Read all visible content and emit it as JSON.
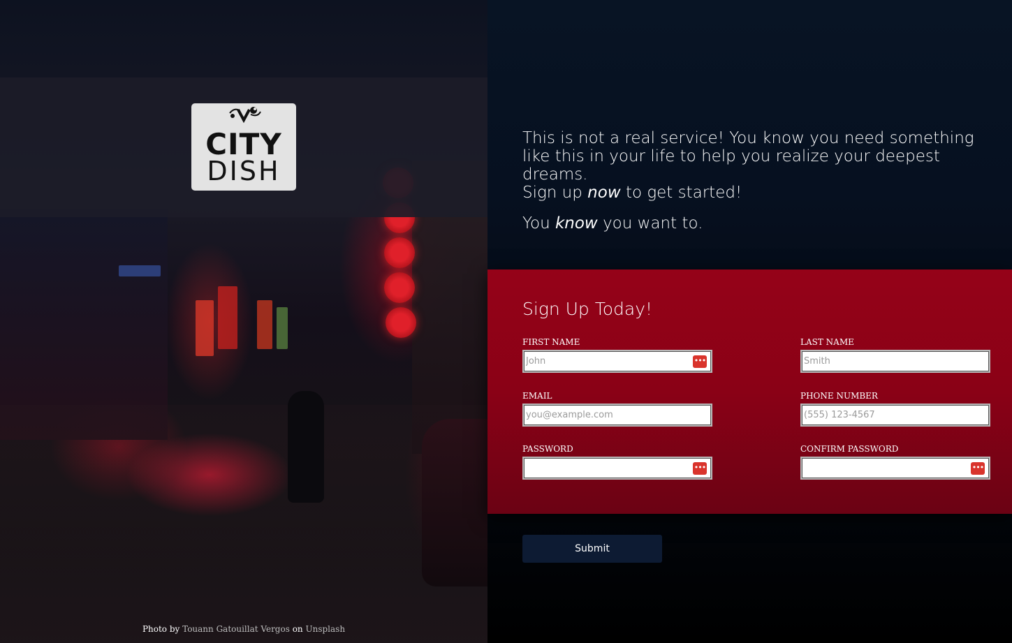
{
  "brand": {
    "logo_line1": "CITY",
    "logo_line2": "DISH"
  },
  "photo_credit": {
    "prefix": "Photo by",
    "author": "Touann Gatouillat Vergos",
    "middle": "on",
    "source": "Unsplash"
  },
  "intro": {
    "line1": "This is not a real service! You know you need something like this in your life to help you realize your deepest dreams.",
    "line2_before": "Sign up",
    "line2_em": "now",
    "line2_after": "to get started!",
    "line3_before": "You",
    "line3_em": "know",
    "line3_after": "you want to."
  },
  "form": {
    "title": "Sign Up Today!",
    "first_name": {
      "label": "First Name",
      "placeholder": "John"
    },
    "last_name": {
      "label": "Last Name",
      "placeholder": "Smith"
    },
    "email": {
      "label": "Email",
      "placeholder": "you@example.com"
    },
    "phone": {
      "label": "Phone Number",
      "placeholder": "(555) 123-4567"
    },
    "password": {
      "label": "Password",
      "placeholder": ""
    },
    "confirm_password": {
      "label": "Confirm Password",
      "placeholder": ""
    },
    "submit_label": "Submit",
    "password_manager_icon": "•••"
  },
  "colors": {
    "form_bg": "#950218",
    "submit_bg": "#0d1b33",
    "page_bg": "#000000",
    "password_icon": "#d9342c"
  }
}
